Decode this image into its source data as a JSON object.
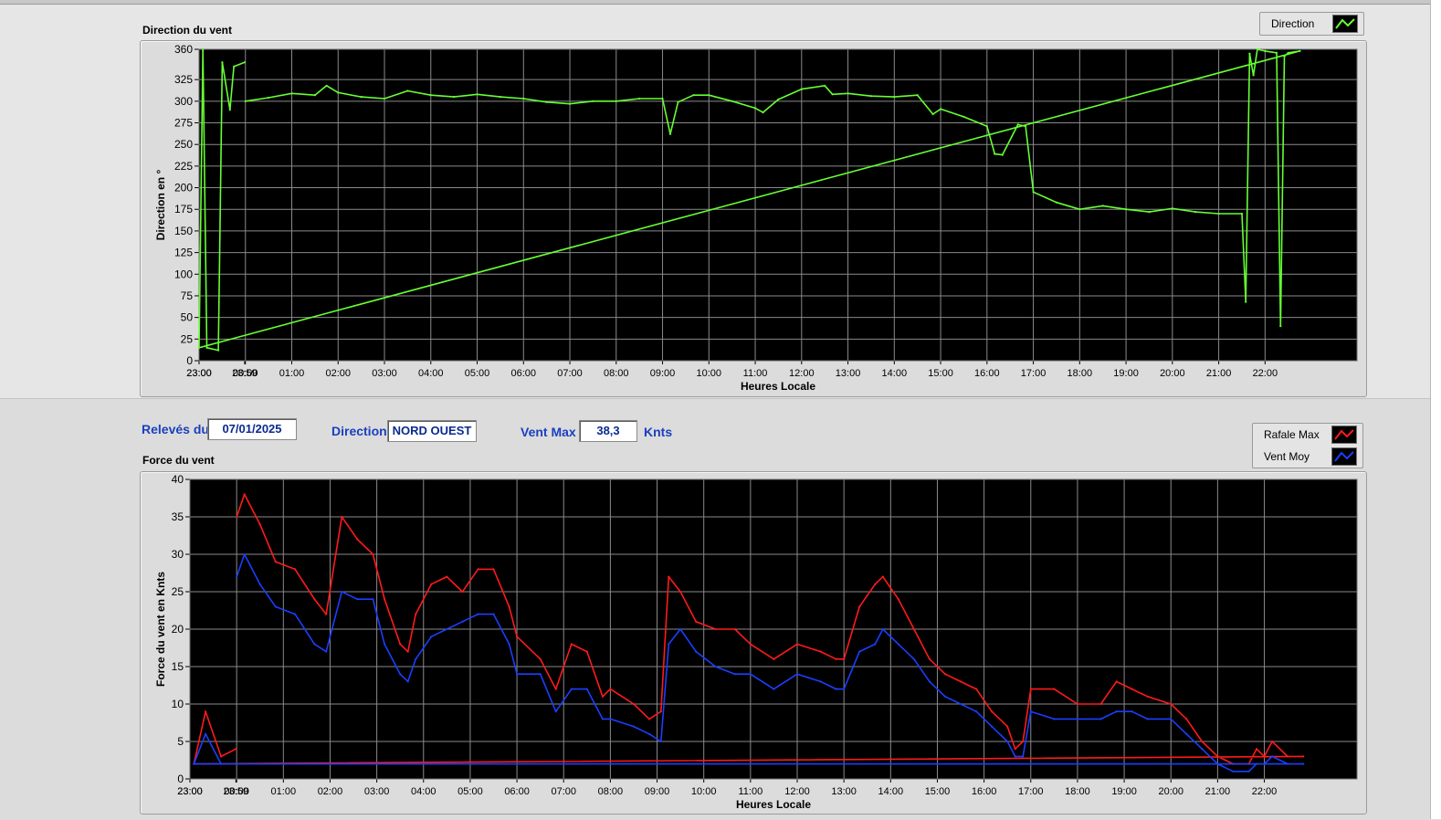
{
  "direction_chart": {
    "title": "Direction du vent",
    "legend": [
      {
        "label": "Direction",
        "color": "#66ff33"
      }
    ]
  },
  "info_bar": {
    "releves_label": "Relevés du",
    "date": "07/01/2025",
    "direction_label": "Direction",
    "direction_value": "NORD OUEST",
    "ventmax_label": "Vent Max",
    "ventmax_value": "38,3",
    "ventmax_unit": "Knts"
  },
  "force_chart": {
    "title": "Force du vent",
    "legend": [
      {
        "label": "Rafale Max",
        "color": "#ff1a1a"
      },
      {
        "label": "Vent Moy",
        "color": "#1a3fff"
      }
    ]
  },
  "chart_data": [
    {
      "type": "line",
      "title": "",
      "xlabel": "Heures Locale",
      "ylabel": "Direction en °",
      "x_ticks": [
        "23:00",
        "00:00",
        "01:00",
        "02:00",
        "03:00",
        "04:00",
        "05:00",
        "06:00",
        "07:00",
        "08:00",
        "09:00",
        "10:00",
        "11:00",
        "12:00",
        "13:00",
        "14:00",
        "15:00",
        "16:00",
        "17:00",
        "18:00",
        "19:00",
        "20:00",
        "21:00",
        "22:00",
        "23:00",
        "23:59"
      ],
      "y_ticks": [
        0,
        25,
        50,
        75,
        100,
        125,
        150,
        175,
        200,
        225,
        250,
        275,
        300,
        325,
        360
      ],
      "ylim": [
        0,
        360
      ],
      "grid": true,
      "legend_position": "top-right",
      "series": [
        {
          "name": "Direction",
          "color": "#66ff33",
          "x": [
            "00:00",
            "00:30",
            "01:00",
            "01:30",
            "01:45",
            "02:00",
            "02:30",
            "03:00",
            "03:30",
            "04:00",
            "04:30",
            "05:00",
            "05:30",
            "06:00",
            "06:30",
            "07:00",
            "07:30",
            "08:00",
            "08:30",
            "09:00",
            "09:10",
            "09:20",
            "09:40",
            "10:00",
            "10:30",
            "11:00",
            "11:10",
            "11:30",
            "12:00",
            "12:30",
            "12:40",
            "13:00",
            "13:30",
            "14:00",
            "14:30",
            "14:50",
            "15:00",
            "15:30",
            "16:00",
            "16:10",
            "16:20",
            "16:40",
            "16:50",
            "17:00",
            "17:30",
            "18:00",
            "18:30",
            "19:00",
            "19:30",
            "20:00",
            "20:30",
            "21:00",
            "21:30",
            "21:35",
            "21:40",
            "21:45",
            "21:50",
            "22:00",
            "22:15",
            "22:20",
            "22:25",
            "22:30",
            "22:45",
            "23:00",
            "23:05",
            "23:10",
            "23:25",
            "23:30",
            "23:40",
            "23:45",
            "23:59"
          ],
          "values": [
            300,
            304,
            309,
            307,
            318,
            310,
            305,
            303,
            312,
            307,
            305,
            308,
            305,
            303,
            299,
            297,
            300,
            300,
            303,
            303,
            262,
            299,
            307,
            307,
            300,
            292,
            287,
            302,
            314,
            318,
            308,
            309,
            306,
            305,
            307,
            285,
            291,
            282,
            271,
            239,
            238,
            273,
            271,
            195,
            183,
            175,
            179,
            175,
            172,
            176,
            172,
            170,
            170,
            68,
            355,
            330,
            360,
            358,
            356,
            40,
            352,
            356,
            358,
            15,
            359,
            15,
            12,
            345,
            290,
            340,
            345
          ]
        }
      ]
    },
    {
      "type": "line",
      "title": "",
      "xlabel": "Heures Locale",
      "ylabel": "Force du vent en Knts",
      "x_ticks": [
        "23:00",
        "00:00",
        "01:00",
        "02:00",
        "03:00",
        "04:00",
        "05:00",
        "06:00",
        "07:00",
        "08:00",
        "09:00",
        "10:00",
        "11:00",
        "12:00",
        "13:00",
        "14:00",
        "15:00",
        "16:00",
        "17:00",
        "18:00",
        "19:00",
        "20:00",
        "21:00",
        "22:00",
        "23:00",
        "23:59"
      ],
      "y_ticks": [
        0,
        5,
        10,
        15,
        20,
        25,
        30,
        35,
        40
      ],
      "ylim": [
        0,
        40
      ],
      "grid": true,
      "legend_position": "top-right",
      "series": [
        {
          "name": "Rafale Max",
          "color": "#ff1a1a",
          "x": [
            "00:00",
            "00:10",
            "00:30",
            "00:50",
            "01:15",
            "01:40",
            "01:55",
            "02:15",
            "02:35",
            "02:55",
            "03:10",
            "03:30",
            "03:40",
            "03:50",
            "04:10",
            "04:30",
            "04:50",
            "05:10",
            "05:30",
            "05:50",
            "06:00",
            "06:30",
            "06:50",
            "07:10",
            "07:30",
            "07:50",
            "08:00",
            "08:30",
            "08:50",
            "09:05",
            "09:15",
            "09:30",
            "09:50",
            "10:15",
            "10:40",
            "11:00",
            "11:30",
            "12:00",
            "12:30",
            "12:50",
            "13:00",
            "13:20",
            "13:40",
            "13:50",
            "14:10",
            "14:30",
            "14:50",
            "15:10",
            "15:30",
            "15:50",
            "16:10",
            "16:30",
            "16:40",
            "16:50",
            "17:00",
            "17:30",
            "18:00",
            "18:30",
            "18:50",
            "19:10",
            "19:30",
            "20:00",
            "20:20",
            "20:40",
            "21:00",
            "21:20",
            "21:40",
            "21:50",
            "22:00",
            "22:10",
            "22:30",
            "22:50",
            "23:05",
            "23:20",
            "23:40",
            "23:59"
          ],
          "values": [
            35,
            38,
            34,
            29,
            28,
            24,
            22,
            35,
            32,
            30,
            24,
            18,
            17,
            22,
            26,
            27,
            25,
            28,
            28,
            23,
            19,
            16,
            12,
            18,
            17,
            11,
            12,
            10,
            8,
            9,
            27,
            25,
            21,
            20,
            20,
            18,
            16,
            18,
            17,
            16,
            16,
            23,
            26,
            27,
            24,
            20,
            16,
            14,
            13,
            12,
            9,
            7,
            4,
            5,
            12,
            12,
            10,
            10,
            13,
            12,
            11,
            10,
            8,
            5,
            3,
            2,
            2,
            4,
            3,
            5,
            3,
            3,
            2,
            9,
            3,
            4
          ]
        },
        {
          "name": "Vent Moy",
          "color": "#1a3fff",
          "x": [
            "00:00",
            "00:10",
            "00:30",
            "00:50",
            "01:15",
            "01:40",
            "01:55",
            "02:15",
            "02:35",
            "02:55",
            "03:10",
            "03:30",
            "03:40",
            "03:50",
            "04:10",
            "04:30",
            "04:50",
            "05:10",
            "05:30",
            "05:50",
            "06:00",
            "06:30",
            "06:50",
            "07:10",
            "07:30",
            "07:50",
            "08:00",
            "08:30",
            "08:50",
            "09:05",
            "09:15",
            "09:30",
            "09:50",
            "10:15",
            "10:40",
            "11:00",
            "11:30",
            "12:00",
            "12:30",
            "12:50",
            "13:00",
            "13:20",
            "13:40",
            "13:50",
            "14:10",
            "14:30",
            "14:50",
            "15:10",
            "15:30",
            "15:50",
            "16:10",
            "16:30",
            "16:40",
            "16:50",
            "17:00",
            "17:30",
            "18:00",
            "18:30",
            "18:50",
            "19:10",
            "19:30",
            "20:00",
            "20:20",
            "20:40",
            "21:00",
            "21:20",
            "21:40",
            "21:50",
            "22:00",
            "22:10",
            "22:30",
            "22:50",
            "23:05",
            "23:20",
            "23:40",
            "23:59"
          ],
          "values": [
            27,
            30,
            26,
            23,
            22,
            18,
            17,
            25,
            24,
            24,
            18,
            14,
            13,
            16,
            19,
            20,
            21,
            22,
            22,
            18,
            14,
            14,
            9,
            12,
            12,
            8,
            8,
            7,
            6,
            5,
            18,
            20,
            17,
            15,
            14,
            14,
            12,
            14,
            13,
            12,
            12,
            17,
            18,
            20,
            18,
            16,
            13,
            11,
            10,
            9,
            7,
            5,
            3,
            3,
            9,
            8,
            8,
            8,
            9,
            9,
            8,
            8,
            6,
            4,
            2,
            1,
            1,
            2,
            2,
            3,
            2,
            2,
            2,
            6,
            2,
            2
          ]
        }
      ]
    }
  ]
}
